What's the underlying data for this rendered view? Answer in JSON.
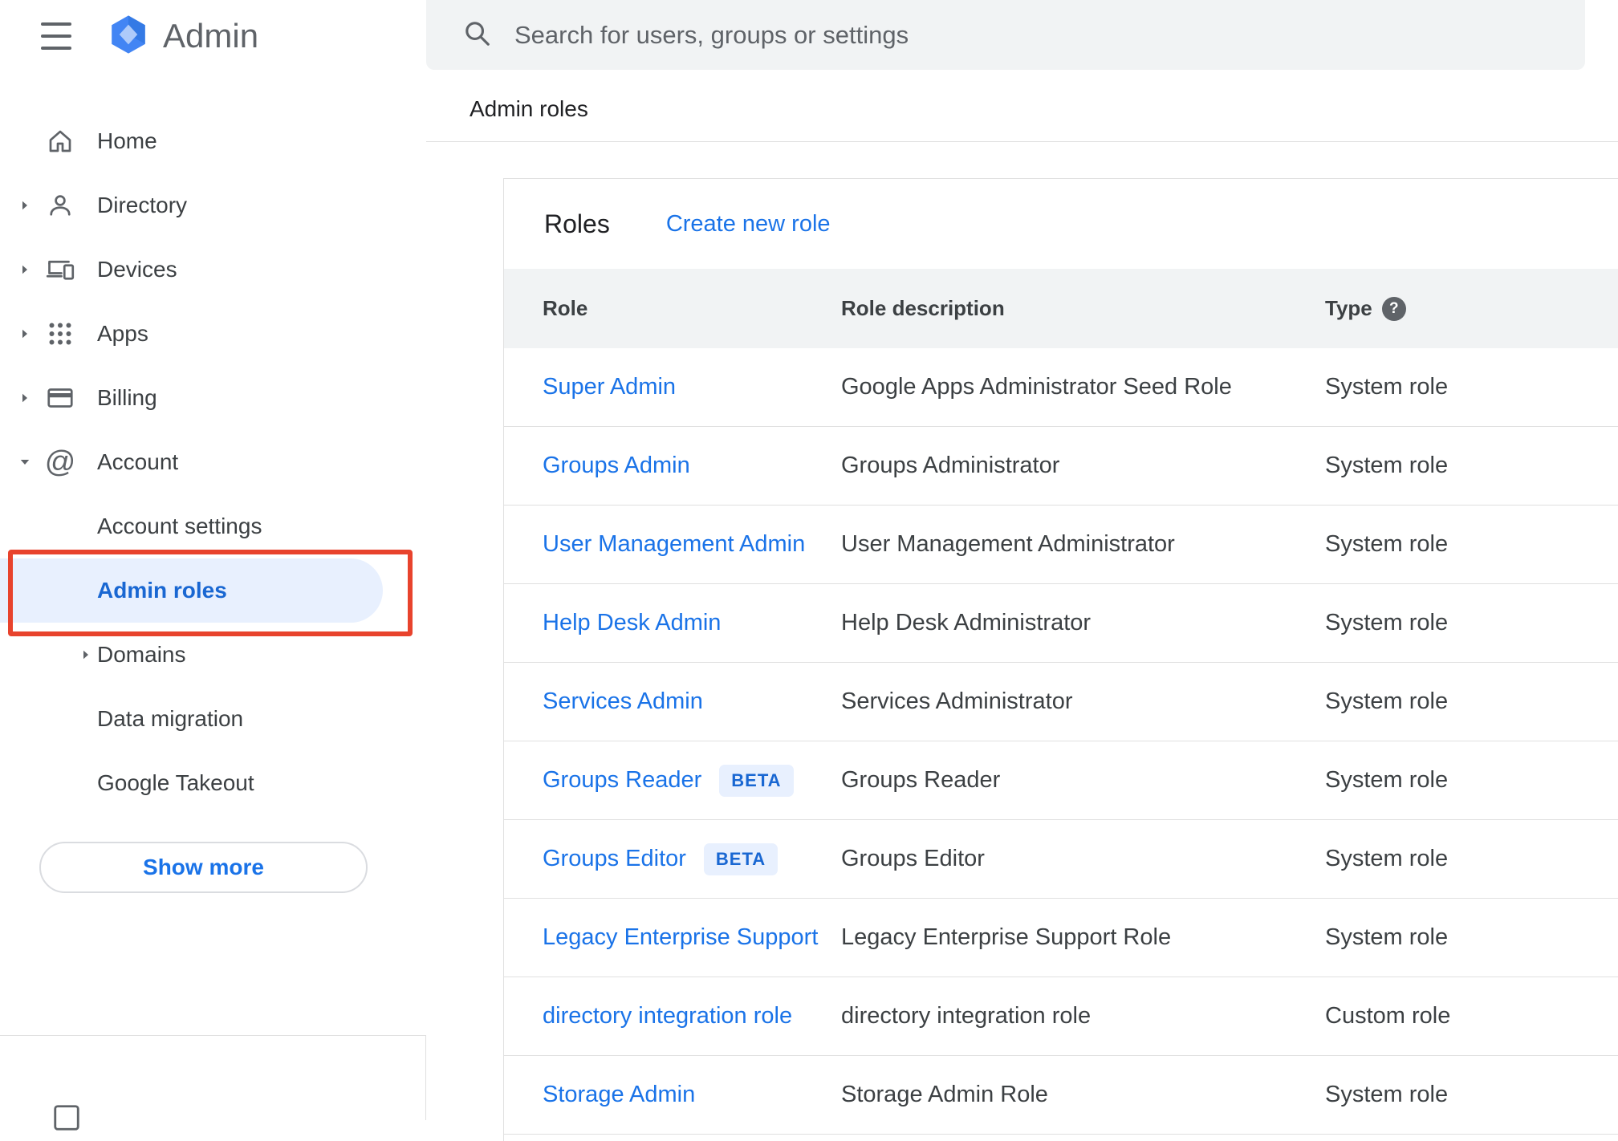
{
  "app": {
    "product": "Admin"
  },
  "search": {
    "placeholder": "Search for users, groups or settings"
  },
  "page": {
    "breadcrumb": "Admin roles"
  },
  "sidebar": {
    "items": [
      {
        "label": "Home"
      },
      {
        "label": "Directory"
      },
      {
        "label": "Devices"
      },
      {
        "label": "Apps"
      },
      {
        "label": "Billing"
      },
      {
        "label": "Account"
      },
      {
        "label": "Account settings"
      },
      {
        "label": "Admin roles"
      },
      {
        "label": "Domains"
      },
      {
        "label": "Data migration"
      },
      {
        "label": "Google Takeout"
      }
    ],
    "show_more": "Show more"
  },
  "roles_card": {
    "title": "Roles",
    "create_link": "Create new role",
    "columns": {
      "role": "Role",
      "description": "Role description",
      "type": "Type"
    },
    "help_glyph": "?",
    "rows": [
      {
        "role": "Super Admin",
        "description": "Google Apps Administrator Seed Role",
        "type": "System role"
      },
      {
        "role": "Groups Admin",
        "description": "Groups Administrator",
        "type": "System role"
      },
      {
        "role": "User Management Admin",
        "description": "User Management Administrator",
        "type": "System role"
      },
      {
        "role": "Help Desk Admin",
        "description": "Help Desk Administrator",
        "type": "System role"
      },
      {
        "role": "Services Admin",
        "description": "Services Administrator",
        "type": "System role"
      },
      {
        "role": "Groups Reader",
        "badge": "BETA",
        "description": "Groups Reader",
        "type": "System role"
      },
      {
        "role": "Groups Editor",
        "badge": "BETA",
        "description": "Groups Editor",
        "type": "System role"
      },
      {
        "role": "Legacy Enterprise Support",
        "description": "Legacy Enterprise Support Role",
        "type": "System role"
      },
      {
        "role": "directory integration role",
        "description": "directory integration role",
        "type": "Custom role"
      },
      {
        "role": "Storage Admin",
        "description": "Storage Admin Role",
        "type": "System role"
      }
    ]
  },
  "colors": {
    "link": "#1a73e8",
    "selected_bg": "#e8f0fe",
    "selected_text": "#1967d2",
    "annotation_red": "#e8432d",
    "table_header_bg": "#f1f3f4",
    "search_bg": "#f1f3f4",
    "divider": "#e0e0e0",
    "text_primary": "#3c4043",
    "text_secondary": "#5f6368",
    "badge_bg": "#e8f0fe",
    "badge_text": "#1967d2",
    "logo_blue": "#4285f4"
  }
}
